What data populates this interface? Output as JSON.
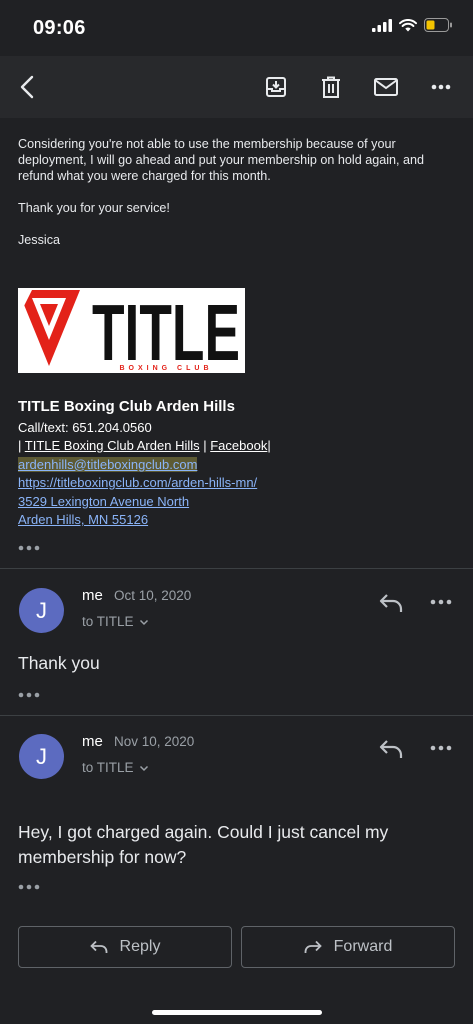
{
  "status_bar": {
    "time": "09:06"
  },
  "email": {
    "paragraphs": [
      "Considering you're not able to use the membership because of your deployment, I will go ahead and put your membership on hold again, and refund what you were charged for this month.",
      "Thank you for your service!",
      "Jessica"
    ],
    "logo_text": "TITLE",
    "logo_subtext": "BOXING CLUB",
    "signature": {
      "name": "TITLE Boxing Club Arden Hills",
      "phone_label": "Call/text:",
      "phone": "651.204.0560",
      "link1": "TITLE Boxing Club Arden Hills",
      "link2": "Facebook",
      "email": "ardenhills@titleboxingclub.com",
      "website": "https://titleboxingclub.com/arden-hills-mn/",
      "address1": "3529 Lexington Avenue North",
      "address2": "Arden Hills, MN 55126"
    }
  },
  "messages": [
    {
      "avatar": "J",
      "sender": "me",
      "date": "Oct 10, 2020",
      "to": "to TITLE",
      "body": "Thank you"
    },
    {
      "avatar": "J",
      "sender": "me",
      "date": "Nov 10, 2020",
      "to": "to TITLE",
      "body": "Hey, I got charged again. Could I just cancel my membership for now?"
    }
  ],
  "actions": {
    "reply": "Reply",
    "forward": "Forward"
  },
  "colors": {
    "background": "#202124",
    "avatar": "#5c6bc0",
    "link": "#8ab4f8",
    "logo_red": "#e32219"
  },
  "icons": [
    "back-icon",
    "archive-icon",
    "delete-icon",
    "mark-unread-icon",
    "more-icon",
    "reply-icon",
    "forward-icon"
  ]
}
